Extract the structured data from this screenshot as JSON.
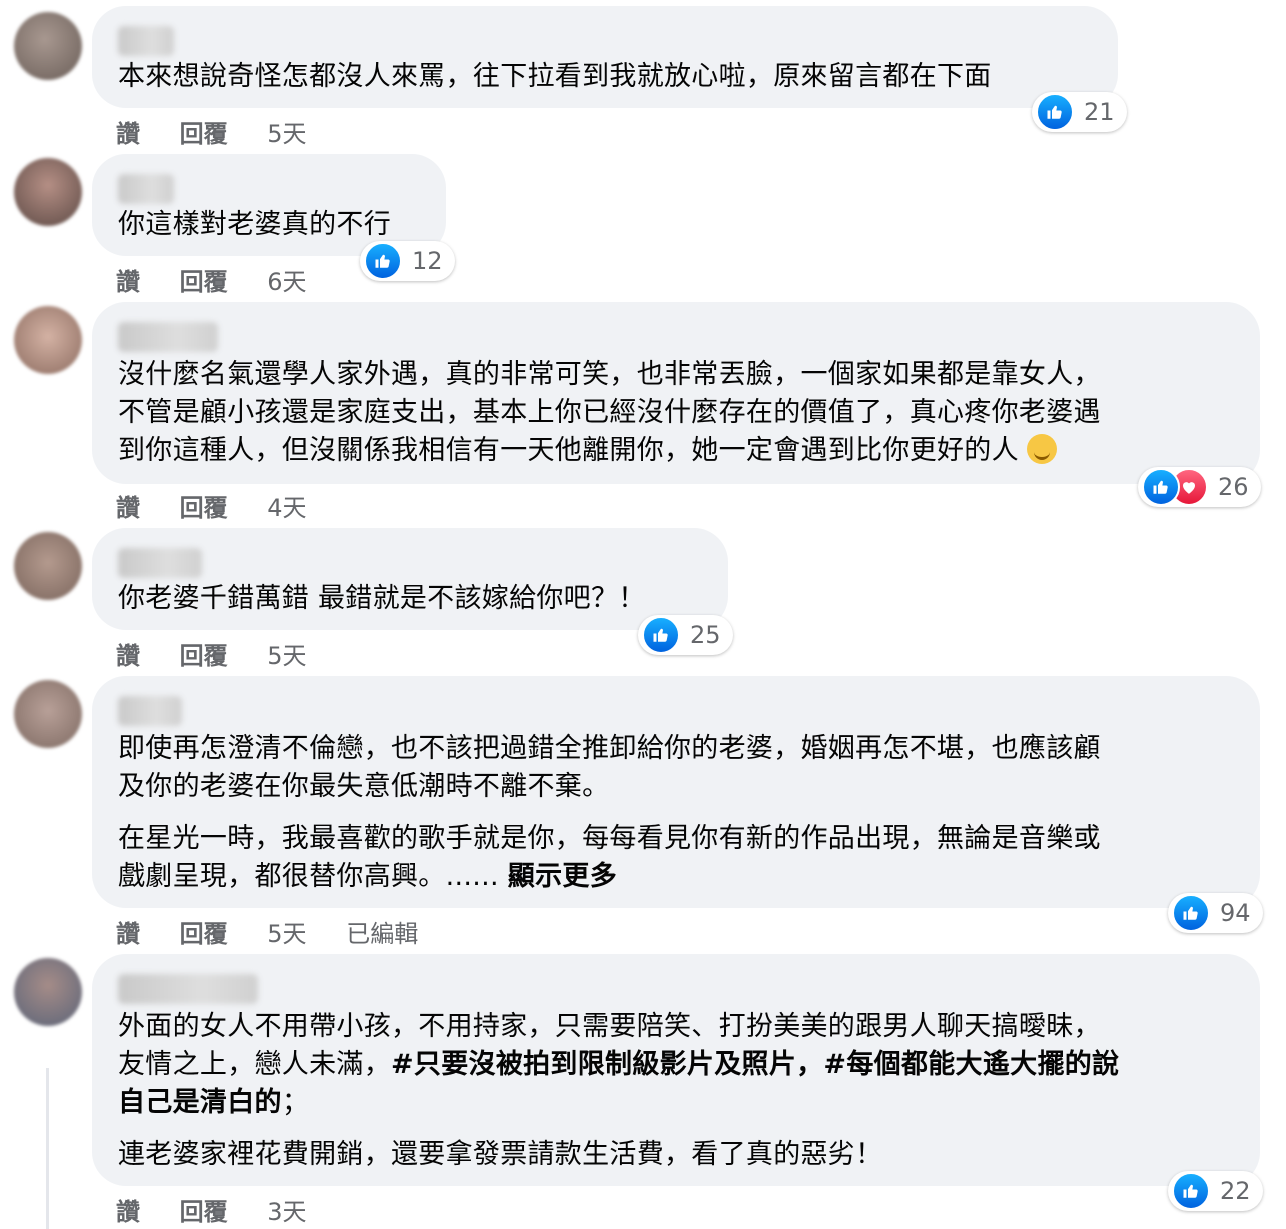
{
  "actions": {
    "like": "讚",
    "reply": "回覆",
    "edited": "已編輯"
  },
  "comments": [
    {
      "author": "",
      "paragraphs": [
        "本來想說奇怪怎都沒人來罵，往下拉看到我就放心啦，原來留言都在下面"
      ],
      "time": "5天",
      "reaction_count": "21",
      "reactions": [
        "like-icon"
      ]
    },
    {
      "author": "",
      "paragraphs": [
        "你這樣對老婆真的不行"
      ],
      "time": "6天",
      "reaction_count": "12",
      "reactions": [
        "like-icon"
      ]
    },
    {
      "author": "",
      "paragraphs": [
        "沒什麼名氣還學人家外遇，真的非常可笑，也非常丟臉，一個家如果都是靠女人，",
        "不管是顧小孩還是家庭支出，基本上你已經沒什麼存在的價值了，真心疼你老婆遇",
        "到你這種人，但沒關係我相信有一天他離開你，她一定會遇到比你更好的人"
      ],
      "emoji": "smiling-face-icon",
      "time": "4天",
      "reaction_count": "26",
      "reactions": [
        "like-icon",
        "love-icon"
      ]
    },
    {
      "author": "",
      "paragraphs": [
        "你老婆千錯萬錯 最錯就是不該嫁給你吧？！"
      ],
      "time": "5天",
      "reaction_count": "25",
      "reactions": [
        "like-icon"
      ]
    },
    {
      "author": "",
      "paragraphs": [
        "即使再怎澄清不倫戀，也不該把過錯全推卸給你的老婆，婚姻再怎不堪，也應該顧",
        "及你的老婆在你最失意低潮時不離不棄。"
      ],
      "paragraphs2": [
        "在星光一時，我最喜歡的歌手就是你，每每看見你有新的作品出現，無論是音樂或",
        "戲劇呈現，都很替你高興。......"
      ],
      "more": "顯示更多",
      "time": "5天",
      "reaction_count": "94",
      "reactions": [
        "like-icon"
      ]
    },
    {
      "author": "",
      "line1": "外面的女人不用帶小孩，不用持家，只需要陪笑、打扮美美的跟男人聊天搞曖昧，",
      "line2_plain": "友情之上，戀人未滿，",
      "line2_bold": "#只要沒被拍到限制級影片及照片，#每個都能大遙大擺的說",
      "line3_bold": "自己是清白的",
      "line3_plain": "；",
      "para2": "連老婆家裡花費開銷，還要拿發票請款生活費，看了真的惡劣！",
      "time": "3天",
      "reaction_count": "22",
      "reactions": [
        "like-icon"
      ]
    }
  ],
  "colors": {
    "bubble": "#f0f2f5",
    "like_blue": "#1877f2",
    "love_red": "#f33e58",
    "meta_gray": "#65676b"
  }
}
